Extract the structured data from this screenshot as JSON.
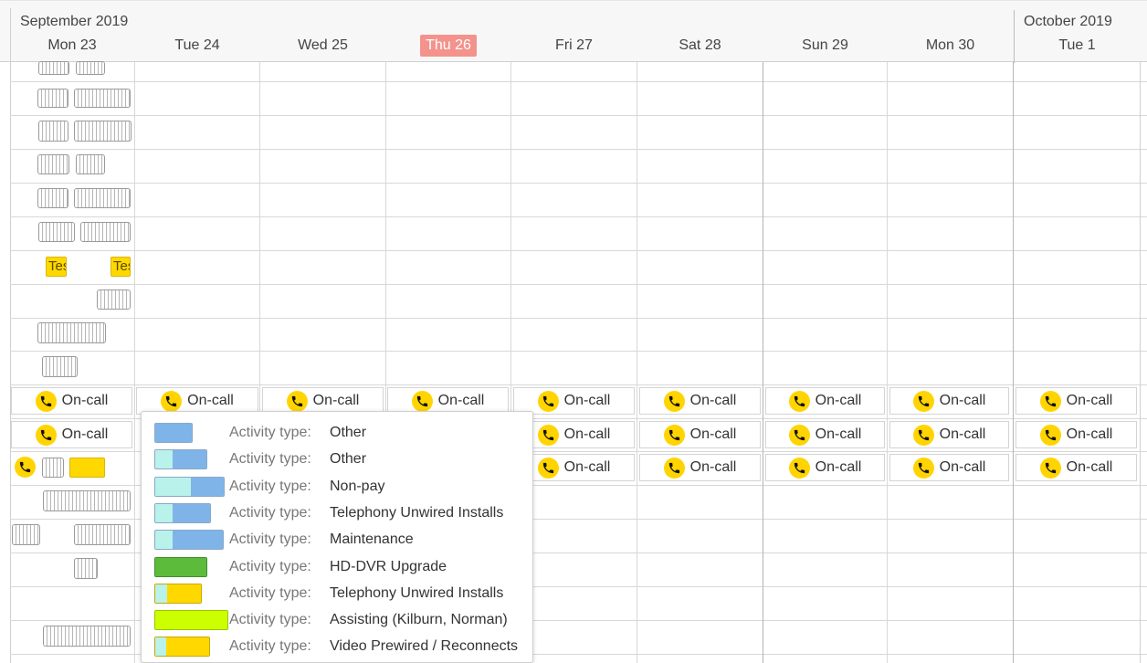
{
  "calendar": {
    "months": [
      {
        "label": "September 2019"
      },
      {
        "label": "October 2019"
      }
    ],
    "days": [
      {
        "label": "Mon 23"
      },
      {
        "label": "Tue 24"
      },
      {
        "label": "Wed 25"
      },
      {
        "label": "Thu 26"
      },
      {
        "label": "Fri 27"
      },
      {
        "label": "Sat 28"
      },
      {
        "label": "Sun 29"
      },
      {
        "label": "Mon 30"
      },
      {
        "label": "Tue 1"
      }
    ],
    "today_index": 3,
    "today_color": "#f3938c"
  },
  "events": {
    "test_label": "Test",
    "oncall_label": "On-call"
  },
  "tooltip": {
    "rows": [
      {
        "label": "Activity type:",
        "value": "Other",
        "colors": [
          "#7fb4e8"
        ]
      },
      {
        "label": "Activity type:",
        "value": "Other",
        "colors": [
          "#b8f2ea",
          "#7fb4e8"
        ]
      },
      {
        "label": "Activity type:",
        "value": "Non-pay",
        "colors": [
          "#b8f2ea",
          "#7fb4e8"
        ]
      },
      {
        "label": "Activity type:",
        "value": "Telephony Unwired Installs",
        "colors": [
          "#b8f2ea",
          "#7fb4e8"
        ]
      },
      {
        "label": "Activity type:",
        "value": "Maintenance",
        "colors": [
          "#b8f2ea",
          "#7fb4e8"
        ]
      },
      {
        "label": "Activity type:",
        "value": "HD-DVR Upgrade",
        "colors": [
          "#5dbb3c"
        ]
      },
      {
        "label": "Activity type:",
        "value": "Telephony Unwired Installs",
        "colors": [
          "#b8f2ea",
          "#ffd800"
        ]
      },
      {
        "label": "Activity type:",
        "value": "Assisting (Kilburn, Norman)",
        "colors": [
          "#ccff00"
        ]
      },
      {
        "label": "Activity type:",
        "value": "Video Prewired / Reconnects",
        "colors": [
          "#b8f2ea",
          "#ffd800"
        ]
      }
    ]
  },
  "colors": {
    "oncall_icon": "#ffd400",
    "event_yellow": "#ffd800"
  },
  "icons": {
    "oncall": "phone-icon"
  }
}
